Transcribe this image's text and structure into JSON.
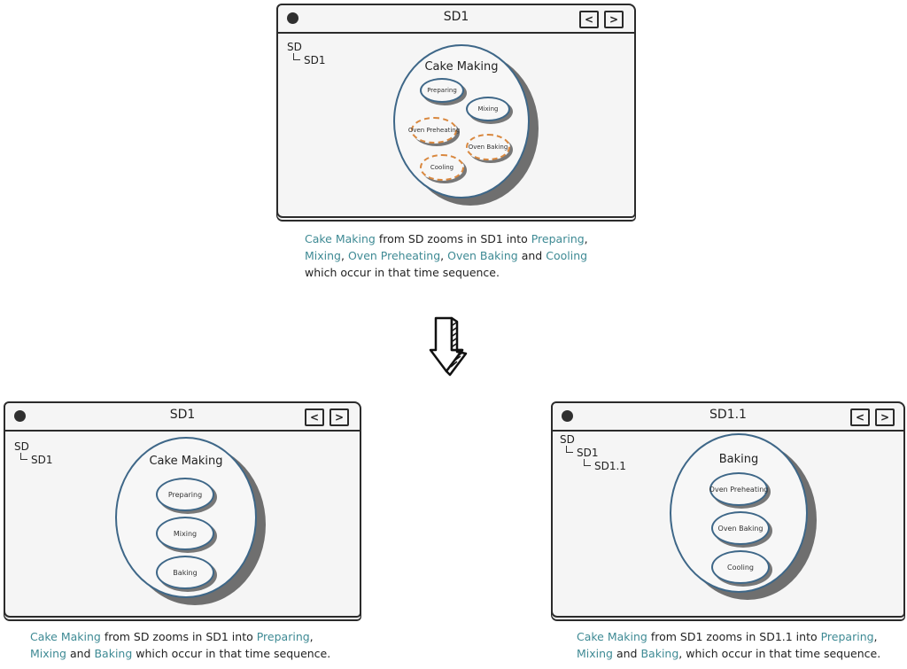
{
  "colors": {
    "accent_text": "#3e8a94",
    "ellipse_border": "#3e6788",
    "dashed_border": "#d9883f",
    "shadow": "#6f6f6f"
  },
  "top": {
    "window_title": "SD1",
    "nav_prev_icon": "<",
    "nav_next_icon": ">",
    "tree": [
      "SD",
      "SD1"
    ],
    "diagram_title": "Cake Making",
    "processes": [
      {
        "label": "Preparing",
        "style": "solid"
      },
      {
        "label": "Mixing",
        "style": "solid"
      },
      {
        "label": "Oven Preheating",
        "style": "dashed"
      },
      {
        "label": "Oven Baking",
        "style": "dashed"
      },
      {
        "label": "Cooling",
        "style": "dashed"
      }
    ],
    "caption": [
      {
        "t": "Cake Making",
        "hl": true
      },
      {
        "t": " from SD zooms in SD1 into ",
        "hl": false
      },
      {
        "t": "Preparing",
        "hl": true
      },
      {
        "t": ",",
        "hl": false
      },
      {
        "br": true
      },
      {
        "t": "Mixing",
        "hl": true
      },
      {
        "t": ", ",
        "hl": false
      },
      {
        "t": "Oven Preheating",
        "hl": true
      },
      {
        "t": ", ",
        "hl": false
      },
      {
        "t": "Oven Baking",
        "hl": true
      },
      {
        "t": " and ",
        "hl": false
      },
      {
        "t": "Cooling",
        "hl": true
      },
      {
        "br": true
      },
      {
        "t": "which occur in that time sequence.",
        "hl": false
      }
    ]
  },
  "arrow_icon": "down-arrow",
  "left": {
    "window_title": "SD1",
    "nav_prev_icon": "<",
    "nav_next_icon": ">",
    "tree": [
      "SD",
      "SD1"
    ],
    "diagram_title": "Cake Making",
    "processes": [
      {
        "label": "Preparing"
      },
      {
        "label": "Mixing"
      },
      {
        "label": "Baking"
      }
    ],
    "caption": [
      {
        "t": "Cake Making",
        "hl": true
      },
      {
        "t": " from SD zooms in SD1 into ",
        "hl": false
      },
      {
        "t": "Preparing",
        "hl": true
      },
      {
        "t": ",",
        "hl": false
      },
      {
        "br": true
      },
      {
        "t": "Mixing",
        "hl": true
      },
      {
        "t": " and ",
        "hl": false
      },
      {
        "t": "Baking",
        "hl": true
      },
      {
        "t": " which occur in that time sequence.",
        "hl": false
      }
    ]
  },
  "right": {
    "window_title": "SD1.1",
    "nav_prev_icon": "<",
    "nav_next_icon": ">",
    "tree": [
      "SD",
      "SD1",
      "SD1.1"
    ],
    "diagram_title": "Baking",
    "processes": [
      {
        "label": "Oven Preheating"
      },
      {
        "label": "Oven Baking"
      },
      {
        "label": "Cooling"
      }
    ],
    "caption": [
      {
        "t": "Cake Making",
        "hl": true
      },
      {
        "t": " from SD1 zooms in SD1.1 into ",
        "hl": false
      },
      {
        "t": "Preparing",
        "hl": true
      },
      {
        "t": ",",
        "hl": false
      },
      {
        "br": true
      },
      {
        "t": "Mixing",
        "hl": true
      },
      {
        "t": " and ",
        "hl": false
      },
      {
        "t": "Baking",
        "hl": true
      },
      {
        "t": ", which occur in that time sequence.",
        "hl": false
      }
    ]
  }
}
